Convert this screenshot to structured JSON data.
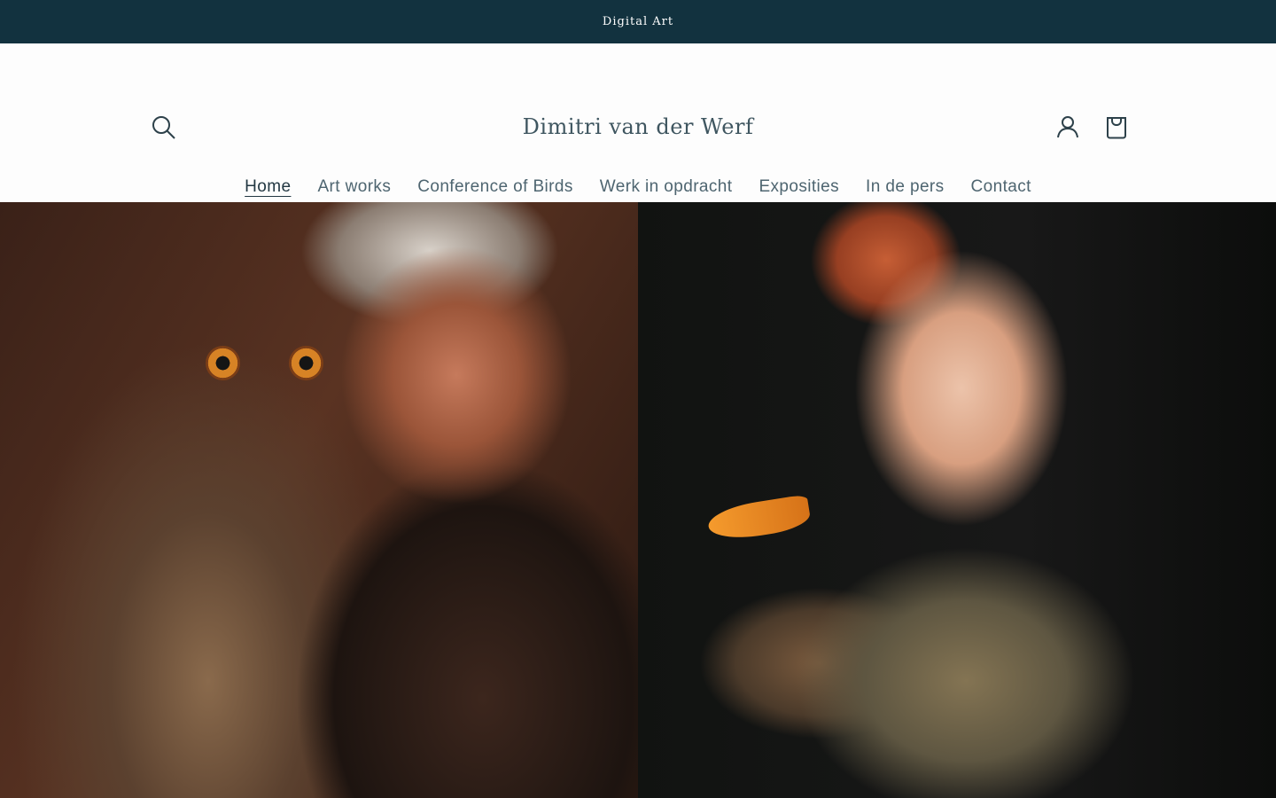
{
  "announcement": {
    "text": "Digital Art"
  },
  "header": {
    "title": "Dimitri van der Werf",
    "icons": {
      "search": "search-icon",
      "account": "account-icon",
      "cart": "cart-icon"
    }
  },
  "navigation": {
    "items": [
      {
        "label": "Home",
        "active": true
      },
      {
        "label": "Art works"
      },
      {
        "label": "Conference of Birds"
      },
      {
        "label": "Werk in opdracht"
      },
      {
        "label": "Exposities"
      },
      {
        "label": "In de pers"
      },
      {
        "label": "Contact"
      }
    ]
  },
  "colors": {
    "announcement_background": "#12323f",
    "page_background": "#fdfdfd",
    "primary_text": "#2a3f49",
    "navigation_text": "#4e6570"
  }
}
